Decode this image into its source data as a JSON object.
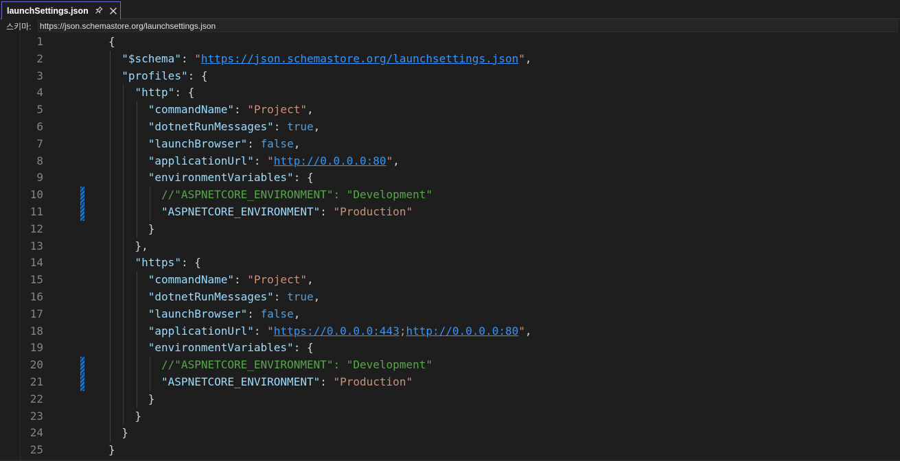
{
  "tab": {
    "title": "launchSettings.json",
    "pin_icon": "pin-icon",
    "close_icon": "close-icon"
  },
  "schema": {
    "label": "스키마:",
    "value": "https://json.schemastore.org/launchsettings.json"
  },
  "colors": {
    "key": "#9cdcfe",
    "string": "#ce9178",
    "keyword": "#569cd6",
    "link": "#3794ff",
    "comment": "#57a64a",
    "line_number": "#858585",
    "change_marker": "#1f7ad8"
  },
  "editor": {
    "changed_lines": [
      10,
      11,
      20,
      21
    ],
    "lines": [
      {
        "n": "1",
        "indent": 0,
        "tokens": [
          [
            "p",
            "{"
          ]
        ]
      },
      {
        "n": "2",
        "indent": 1,
        "tokens": [
          [
            "k",
            "\"$schema\""
          ],
          [
            "p",
            ": "
          ],
          [
            "s",
            "\""
          ],
          [
            "u",
            "https://json.schemastore.org/launchsettings.json"
          ],
          [
            "s",
            "\""
          ],
          [
            "p",
            ","
          ]
        ]
      },
      {
        "n": "3",
        "indent": 1,
        "tokens": [
          [
            "k",
            "\"profiles\""
          ],
          [
            "p",
            ": {"
          ]
        ]
      },
      {
        "n": "4",
        "indent": 2,
        "tokens": [
          [
            "k",
            "\"http\""
          ],
          [
            "p",
            ": {"
          ]
        ]
      },
      {
        "n": "5",
        "indent": 3,
        "tokens": [
          [
            "k",
            "\"commandName\""
          ],
          [
            "p",
            ": "
          ],
          [
            "s",
            "\"Project\""
          ],
          [
            "p",
            ","
          ]
        ]
      },
      {
        "n": "6",
        "indent": 3,
        "tokens": [
          [
            "k",
            "\"dotnetRunMessages\""
          ],
          [
            "p",
            ": "
          ],
          [
            "b",
            "true"
          ],
          [
            "p",
            ","
          ]
        ]
      },
      {
        "n": "7",
        "indent": 3,
        "tokens": [
          [
            "k",
            "\"launchBrowser\""
          ],
          [
            "p",
            ": "
          ],
          [
            "b",
            "false"
          ],
          [
            "p",
            ","
          ]
        ]
      },
      {
        "n": "8",
        "indent": 3,
        "tokens": [
          [
            "k",
            "\"applicationUrl\""
          ],
          [
            "p",
            ": "
          ],
          [
            "s",
            "\""
          ],
          [
            "u",
            "http://0.0.0.0:80"
          ],
          [
            "s",
            "\""
          ],
          [
            "p",
            ","
          ]
        ]
      },
      {
        "n": "9",
        "indent": 3,
        "tokens": [
          [
            "k",
            "\"environmentVariables\""
          ],
          [
            "p",
            ": {"
          ]
        ]
      },
      {
        "n": "10",
        "indent": 4,
        "tokens": [
          [
            "c",
            "//\"ASPNETCORE_ENVIRONMENT\": \"Development\""
          ]
        ]
      },
      {
        "n": "11",
        "indent": 4,
        "tokens": [
          [
            "k",
            "\"ASPNETCORE_ENVIRONMENT\""
          ],
          [
            "p",
            ": "
          ],
          [
            "s",
            "\"Production\""
          ]
        ]
      },
      {
        "n": "12",
        "indent": 3,
        "tokens": [
          [
            "p",
            "}"
          ]
        ]
      },
      {
        "n": "13",
        "indent": 2,
        "tokens": [
          [
            "p",
            "},"
          ]
        ]
      },
      {
        "n": "14",
        "indent": 2,
        "tokens": [
          [
            "k",
            "\"https\""
          ],
          [
            "p",
            ": {"
          ]
        ]
      },
      {
        "n": "15",
        "indent": 3,
        "tokens": [
          [
            "k",
            "\"commandName\""
          ],
          [
            "p",
            ": "
          ],
          [
            "s",
            "\"Project\""
          ],
          [
            "p",
            ","
          ]
        ]
      },
      {
        "n": "16",
        "indent": 3,
        "tokens": [
          [
            "k",
            "\"dotnetRunMessages\""
          ],
          [
            "p",
            ": "
          ],
          [
            "b",
            "true"
          ],
          [
            "p",
            ","
          ]
        ]
      },
      {
        "n": "17",
        "indent": 3,
        "tokens": [
          [
            "k",
            "\"launchBrowser\""
          ],
          [
            "p",
            ": "
          ],
          [
            "b",
            "false"
          ],
          [
            "p",
            ","
          ]
        ]
      },
      {
        "n": "18",
        "indent": 3,
        "tokens": [
          [
            "k",
            "\"applicationUrl\""
          ],
          [
            "p",
            ": "
          ],
          [
            "s",
            "\""
          ],
          [
            "u",
            "https://0.0.0.0:443"
          ],
          [
            "s",
            ";"
          ],
          [
            "u",
            "http://0.0.0.0:80"
          ],
          [
            "s",
            "\""
          ],
          [
            "p",
            ","
          ]
        ]
      },
      {
        "n": "19",
        "indent": 3,
        "tokens": [
          [
            "k",
            "\"environmentVariables\""
          ],
          [
            "p",
            ": {"
          ]
        ]
      },
      {
        "n": "20",
        "indent": 4,
        "tokens": [
          [
            "c",
            "//\"ASPNETCORE_ENVIRONMENT\": \"Development\""
          ]
        ]
      },
      {
        "n": "21",
        "indent": 4,
        "tokens": [
          [
            "k",
            "\"ASPNETCORE_ENVIRONMENT\""
          ],
          [
            "p",
            ": "
          ],
          [
            "s",
            "\"Production\""
          ]
        ]
      },
      {
        "n": "22",
        "indent": 3,
        "tokens": [
          [
            "p",
            "}"
          ]
        ]
      },
      {
        "n": "23",
        "indent": 2,
        "tokens": [
          [
            "p",
            "}"
          ]
        ]
      },
      {
        "n": "24",
        "indent": 1,
        "tokens": [
          [
            "p",
            "}"
          ]
        ]
      },
      {
        "n": "25",
        "indent": 0,
        "tokens": [
          [
            "p",
            "}"
          ]
        ]
      }
    ]
  }
}
